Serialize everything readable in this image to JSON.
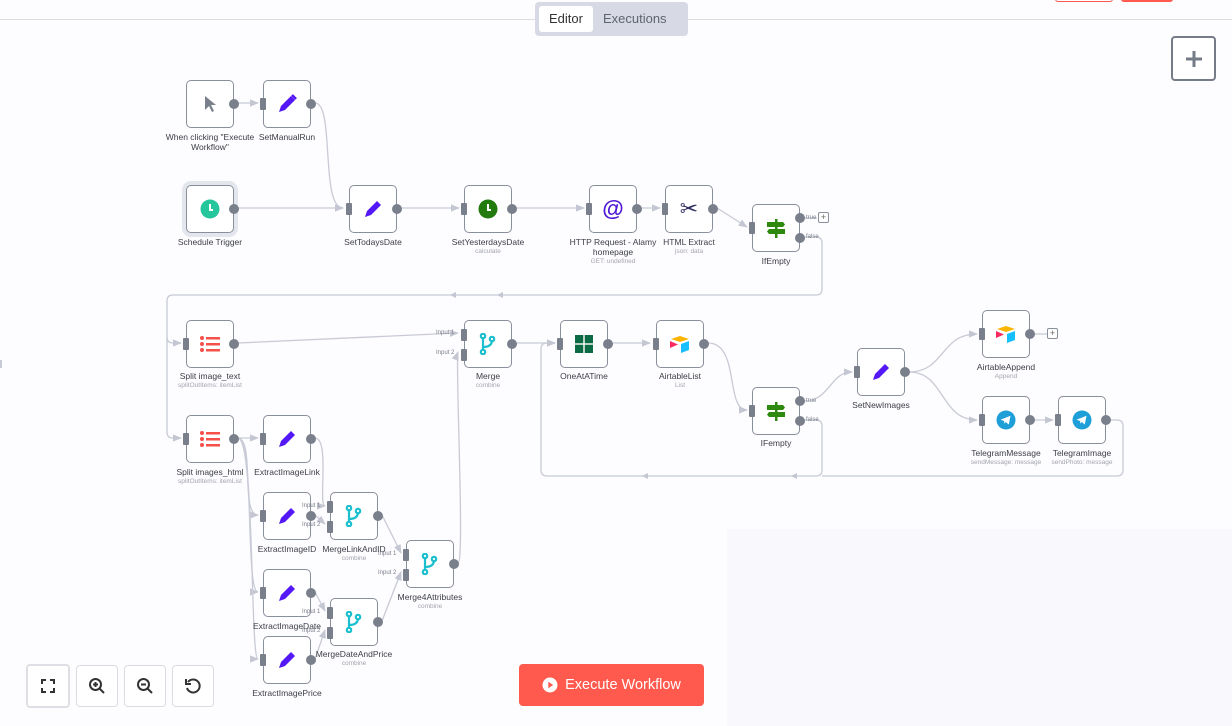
{
  "header": {
    "tabs": [
      {
        "label": "Editor",
        "active": true
      },
      {
        "label": "Executions",
        "active": false
      }
    ]
  },
  "colors": {
    "accent_red": "#ff5a4d",
    "node_border": "#8a8f9c",
    "edge": "#c8cbd6",
    "set_icon": "#5417f5",
    "merge_icon": "#1bbfce",
    "if_icon": "#2e8a0e",
    "schedule_icon": "#26c69c",
    "telegram_icon": "#1e9fd8",
    "split_icon": "#f5504a"
  },
  "canvas": {
    "add_node_icon": "plus-icon",
    "nodes": [
      {
        "id": "manual",
        "label": "When clicking \"Execute Workflow\"",
        "sub": "",
        "icon": "cursor-icon"
      },
      {
        "id": "setManualRun",
        "label": "SetManualRun",
        "sub": "",
        "icon": "pencil-icon"
      },
      {
        "id": "schedule",
        "label": "Schedule Trigger",
        "sub": "",
        "icon": "clock-icon"
      },
      {
        "id": "setTodays",
        "label": "SetTodaysDate",
        "sub": "",
        "icon": "pencil-icon"
      },
      {
        "id": "setYesterdays",
        "label": "SetYesterdaysDate",
        "sub": "calculate",
        "icon": "clock-icon"
      },
      {
        "id": "http",
        "label": "HTTP Request - Alamy homepage",
        "sub": "GET: undefined",
        "icon": "at-icon"
      },
      {
        "id": "htmlExtract",
        "label": "HTML Extract",
        "sub": "json: data",
        "icon": "scissors-icon"
      },
      {
        "id": "ifEmpty1",
        "label": "IfEmpty",
        "sub": "",
        "icon": "signpost-icon",
        "ports": [
          "true",
          "false"
        ]
      },
      {
        "id": "splitText",
        "label": "Split image_text",
        "sub": "splitOutItems: itemList",
        "icon": "list-icon"
      },
      {
        "id": "merge",
        "label": "Merge",
        "sub": "combine",
        "icon": "merge-icon",
        "inputs": [
          "Input 1",
          "Input 2"
        ]
      },
      {
        "id": "oneAtATime",
        "label": "OneAtATime",
        "sub": "",
        "icon": "grid-icon"
      },
      {
        "id": "airtableList",
        "label": "AirtableList",
        "sub": "List",
        "icon": "airtable-icon"
      },
      {
        "id": "ifEmpty2",
        "label": "IFempty",
        "sub": "",
        "icon": "signpost-icon",
        "ports": [
          "true",
          "false"
        ]
      },
      {
        "id": "setNewImages",
        "label": "SetNewImages",
        "sub": "",
        "icon": "pencil-icon"
      },
      {
        "id": "airtableAppend",
        "label": "AirtableAppend",
        "sub": "Append",
        "icon": "airtable-icon"
      },
      {
        "id": "telegramMessage",
        "label": "TelegramMessage",
        "sub": "sendMessage: message",
        "icon": "telegram-icon"
      },
      {
        "id": "telegramImage",
        "label": "TelegramImage",
        "sub": "sendPhoto: message",
        "icon": "telegram-icon"
      },
      {
        "id": "splitHtml",
        "label": "Split images_html",
        "sub": "splitOutItems: itemList",
        "icon": "list-icon"
      },
      {
        "id": "extractLink",
        "label": "ExtractImageLink",
        "sub": "",
        "icon": "pencil-icon"
      },
      {
        "id": "extractID",
        "label": "ExtractImageID",
        "sub": "",
        "icon": "pencil-icon"
      },
      {
        "id": "mergeLinkID",
        "label": "MergeLinkAndID",
        "sub": "combine",
        "icon": "merge-icon",
        "inputs": [
          "Input 1",
          "Input 2"
        ]
      },
      {
        "id": "merge4",
        "label": "Merge4Attributes",
        "sub": "combine",
        "icon": "merge-icon",
        "inputs": [
          "Input 1",
          "Input 2"
        ]
      },
      {
        "id": "extractDate",
        "label": "ExtractImageDate",
        "sub": "",
        "icon": "pencil-icon"
      },
      {
        "id": "mergeDatePrice",
        "label": "MergeDateAndPrice",
        "sub": "combine",
        "icon": "merge-icon",
        "inputs": [
          "Input 1",
          "Input 2"
        ]
      },
      {
        "id": "extractPrice",
        "label": "ExtractImagePrice",
        "sub": "",
        "icon": "pencil-icon"
      }
    ],
    "port_labels": {
      "true": "true",
      "false": "false",
      "input1": "Input 1",
      "input2": "Input 2"
    }
  },
  "controls": {
    "zoom_buttons": [
      {
        "name": "fit-view",
        "icon": "fullscreen-icon"
      },
      {
        "name": "zoom-in",
        "icon": "zoom-in-icon"
      },
      {
        "name": "zoom-out",
        "icon": "zoom-out-icon"
      },
      {
        "name": "reset-zoom",
        "icon": "undo-icon"
      }
    ],
    "execute_label": "Execute Workflow",
    "execute_icon": "play-circle-icon"
  }
}
